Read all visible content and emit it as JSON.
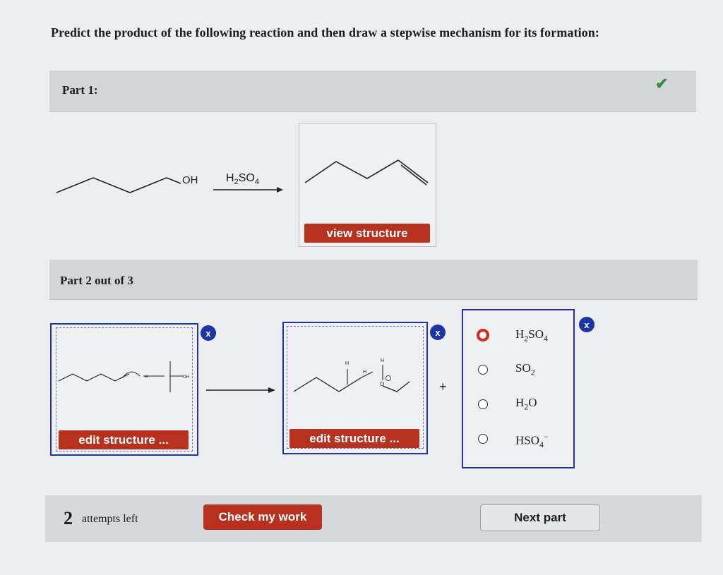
{
  "question": "Predict the product of the following reaction and then draw a stepwise mechanism for its formation:",
  "part1": {
    "title": "Part 1:",
    "reagent": "H2SO4",
    "oh_label": "OH",
    "view_button": "view structure",
    "status": "correct"
  },
  "part2": {
    "title": "Part 2 out of 3",
    "edit_button_1": "edit structure ...",
    "edit_button_2": "edit structure ...",
    "remove_label": "x",
    "plus": "+",
    "h_label": "H",
    "oh_small": "OH",
    "choices": [
      "H2SO4",
      "SO2",
      "H2O",
      "HSO4−"
    ],
    "selected_choice": "H2SO4"
  },
  "footer": {
    "attempts_count": "2",
    "attempts_text": "attempts left",
    "check_button": "Check my work",
    "next_button": "Next part"
  },
  "colors": {
    "accent_red": "#b8311f",
    "accent_blue": "#1c34a8",
    "check_green": "#3b8a35"
  }
}
